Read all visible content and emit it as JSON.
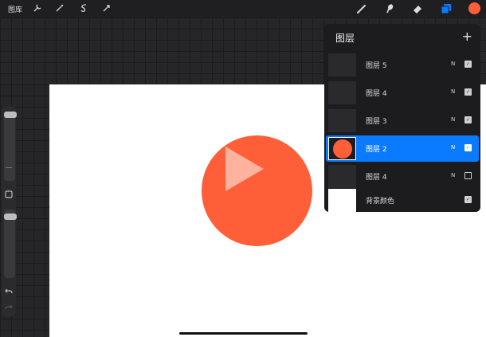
{
  "topbar": {
    "gallery_label": "图库",
    "tools_left": [
      "wrench-icon",
      "magic-wand-icon",
      "selection-icon",
      "transform-arrow-icon"
    ],
    "tools_right": [
      "brush-icon",
      "smudge-icon",
      "eraser-icon",
      "layers-icon",
      "color-swatch"
    ]
  },
  "colors": {
    "accent": "#0a7aff",
    "brush_color": "#fe5f38"
  },
  "layers_panel": {
    "title": "图层",
    "add_label": "+",
    "layers": [
      {
        "name": "图层 5",
        "mode": "N",
        "visible": true,
        "active": false
      },
      {
        "name": "图层 4",
        "mode": "N",
        "visible": true,
        "active": false
      },
      {
        "name": "图层 3",
        "mode": "N",
        "visible": true,
        "active": false
      },
      {
        "name": "图层 2",
        "mode": "N",
        "visible": true,
        "active": true
      },
      {
        "name": "图层 4",
        "mode": "N",
        "visible": false,
        "active": false
      },
      {
        "name": "背景颜色",
        "mode": "",
        "visible": true,
        "active": false
      }
    ]
  }
}
